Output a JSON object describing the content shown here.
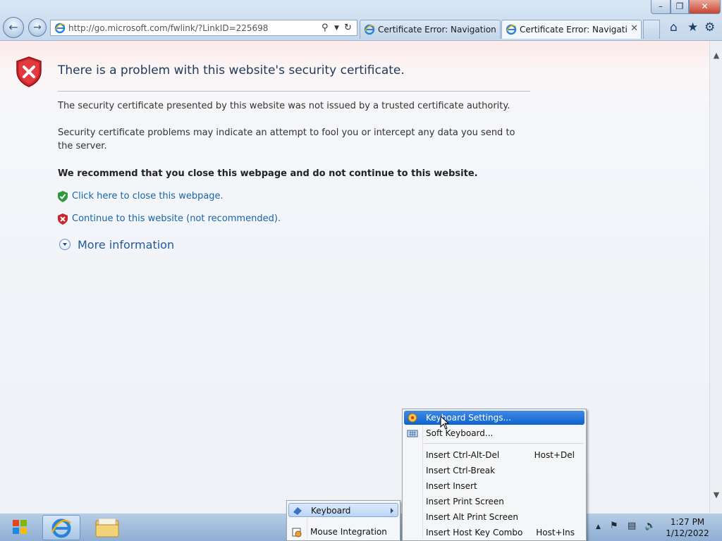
{
  "browser": {
    "address_url": "http://go.microsoft.com/fwlink/?LinkID=225698",
    "tabs": [
      {
        "label": "Certificate Error: Navigation Bl..."
      },
      {
        "label": "Certificate Error: Navigation..."
      }
    ]
  },
  "page": {
    "title": "There is a problem with this website's security certificate.",
    "para1": "The security certificate presented by this website was not issued by a trusted certificate authority.",
    "para2": "Security certificate problems may indicate an attempt to fool you or intercept any data you send to the server.",
    "recommend": "We recommend that you close this webpage and do not continue to this website.",
    "close_link": "Click here to close this webpage.",
    "continue_link": "Continue to this website (not recommended).",
    "more_info": "More information"
  },
  "vm_menu": {
    "items": [
      {
        "label": "Keyboard"
      },
      {
        "label": "Mouse Integration"
      }
    ]
  },
  "keyboard_menu": {
    "items": [
      {
        "label": "Keyboard Settings...",
        "shortcut": ""
      },
      {
        "label": "Soft Keyboard...",
        "shortcut": ""
      },
      {
        "label": "Insert Ctrl-Alt-Del",
        "shortcut": "Host+Del"
      },
      {
        "label": "Insert Ctrl-Break",
        "shortcut": ""
      },
      {
        "label": "Insert Insert",
        "shortcut": ""
      },
      {
        "label": "Insert Print Screen",
        "shortcut": ""
      },
      {
        "label": "Insert Alt Print Screen",
        "shortcut": ""
      },
      {
        "label": "Insert Host Key Combo",
        "shortcut": "Host+Ins"
      }
    ]
  },
  "taskbar": {
    "clock_time": "1:27 PM",
    "clock_date": "1/12/2022"
  },
  "colors": {
    "link": "#1565a8",
    "highlight": "#0f63cf",
    "error_red": "#c8262c"
  }
}
